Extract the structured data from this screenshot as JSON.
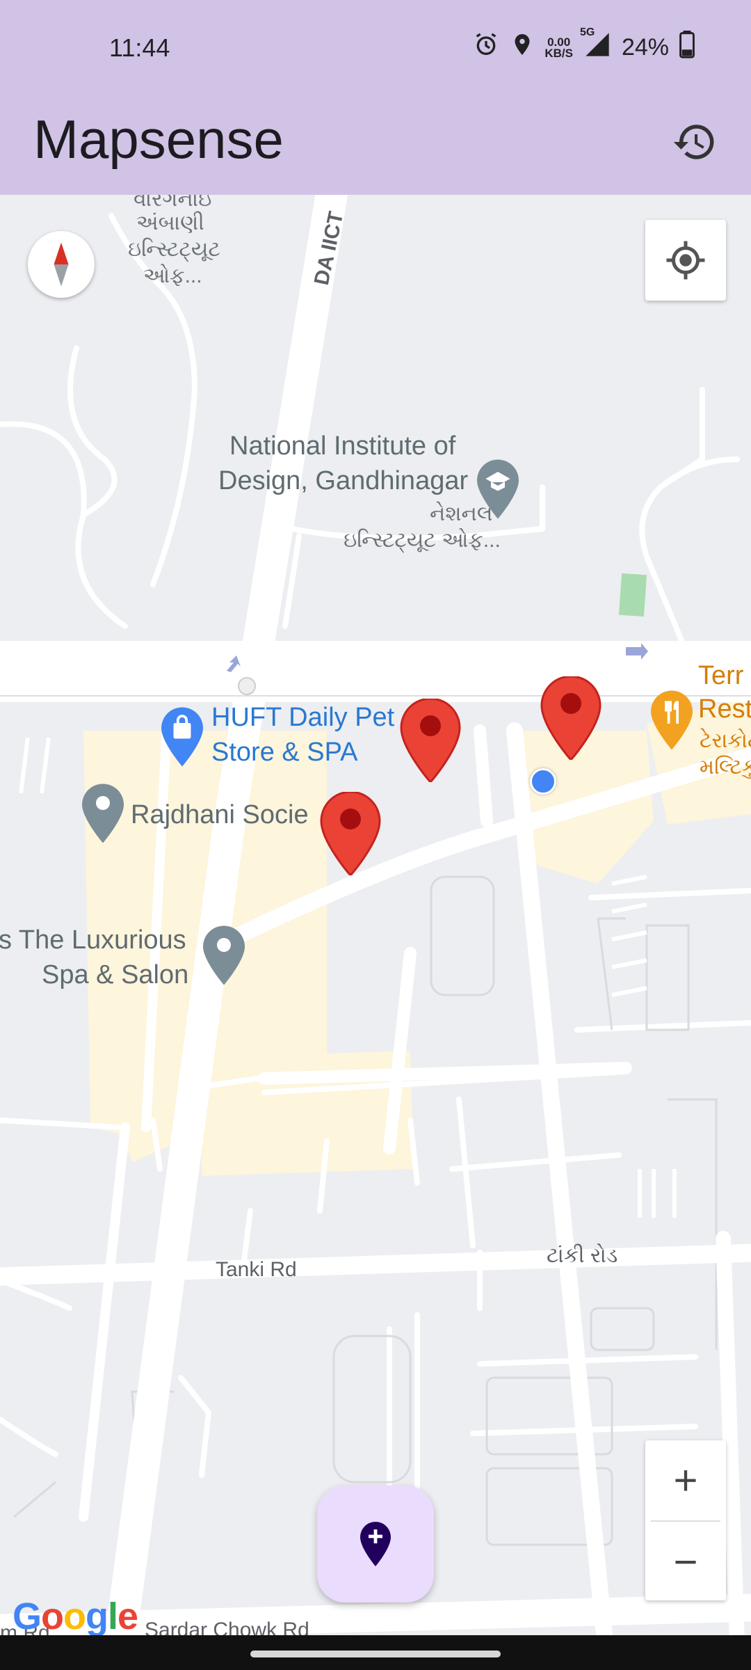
{
  "status_bar": {
    "time": "11:44",
    "network_speed": "0.00",
    "network_unit": "KB/S",
    "network_type": "5G",
    "battery": "24%",
    "icons": [
      "alarm-icon",
      "location-icon",
      "signal-icon",
      "battery-icon"
    ]
  },
  "app_bar": {
    "title": "Mapsense",
    "history_icon": "history-icon"
  },
  "map": {
    "labels": {
      "top_gu_1": "વારગનાઇ",
      "top_gu_2": "અંબાણી",
      "top_gu_3": "ઇન્સ્ટિટ્યૂટ",
      "top_gu_4": "ઓફ...",
      "road_da_iict": "DA IICT",
      "nid_line1": "National Institute of",
      "nid_line2": "Design, Gandhinagar",
      "nid_gu_line1": "નેશનલ",
      "nid_gu_line2": "ઇન્સ્ટિટ્યૂટ ઓફ...",
      "huft_line1": "HUFT Daily Pet",
      "huft_line2": "Store & SPA",
      "rajdhani": "Rajdhani Socie",
      "terr_line1": "Terr",
      "terr_line2": "Rest",
      "terr_gu_line1": "ટેરાકોટ",
      "terr_gu_line2": "મલ્ટિકુ",
      "spa_line1": "s The Luxurious",
      "spa_line2": "Spa & Salon",
      "tanki_rd": "Tanki Rd",
      "tanki_gu": "ટાંકી રોડ",
      "sardar_chowk": "Sardar Chowk Rd",
      "m_rd": "m Rd"
    },
    "markers": [
      "red-marker",
      "red-marker",
      "red-marker"
    ],
    "colors": {
      "marker": "#ea4335",
      "user_location": "#4285f4",
      "campus": "#fdf5dc",
      "road": "#ffffff",
      "poi_gray": "#7b8d96",
      "poi_blue": "#4285f4",
      "poi_orange": "#f2a21f"
    }
  },
  "controls": {
    "compass_icon": "compass-icon",
    "my_location_icon": "my-location-icon",
    "zoom_in": "+",
    "zoom_out": "−"
  },
  "fab": {
    "icon": "add-location-icon"
  },
  "attribution": {
    "google": "Google"
  }
}
